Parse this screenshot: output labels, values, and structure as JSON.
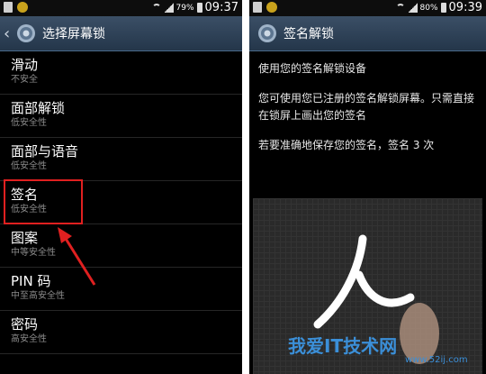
{
  "left": {
    "status": {
      "battery": "79%",
      "time": "09:37"
    },
    "title": "选择屏幕锁",
    "items": [
      {
        "title": "滑动",
        "sub": "不安全"
      },
      {
        "title": "面部解锁",
        "sub": "低安全性"
      },
      {
        "title": "面部与语音",
        "sub": "低安全性"
      },
      {
        "title": "签名",
        "sub": "低安全性"
      },
      {
        "title": "图案",
        "sub": "中等安全性"
      },
      {
        "title": "PIN 码",
        "sub": "中至高安全性"
      },
      {
        "title": "密码",
        "sub": "高安全性"
      }
    ]
  },
  "right": {
    "status": {
      "battery": "80%",
      "time": "09:39"
    },
    "title": "签名解锁",
    "lines": [
      "使用您的签名解锁设备",
      "您可使用您已注册的签名解锁屏幕。只需直接在锁屏上画出您的签名",
      "若要准确地保存您的签名，签名 3 次"
    ],
    "signature_char": "人"
  },
  "watermark": {
    "text": "我爱IT技术网",
    "url": "www.52ij.com"
  },
  "colors": {
    "highlight": "#e02020",
    "titlebar": "#2f4259",
    "accent": "#3b8fd8"
  }
}
